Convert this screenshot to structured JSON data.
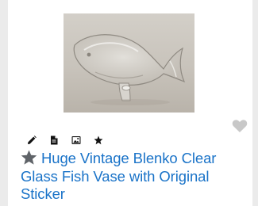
{
  "listing": {
    "title": "Huge Vintage Blenko Clear Glass Fish Vase with Original Sticker",
    "image_alt": "Clear glass fish vase",
    "accent_color": "#1a73c8"
  },
  "toolbar": {
    "items": [
      {
        "icon": "pencil-icon"
      },
      {
        "icon": "document-icon"
      },
      {
        "icon": "image-icon"
      },
      {
        "icon": "star-icon"
      }
    ]
  },
  "actions": {
    "favorite_icon": "heart-icon",
    "favorite_color": "#c8c8c8"
  }
}
